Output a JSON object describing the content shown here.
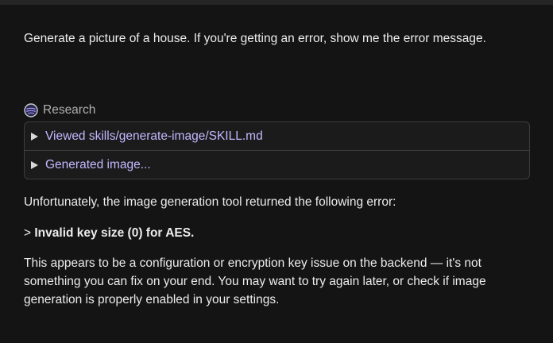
{
  "user_message": "Generate a picture of a house. If you're getting an error, show me the error message.",
  "research": {
    "label": "Research",
    "icon": "research-globe-icon",
    "items": [
      {
        "label": "Viewed skills/generate-image/SKILL.md"
      },
      {
        "label": "Generated image..."
      }
    ]
  },
  "response": {
    "intro": "Unfortunately, the image generation tool returned the following error:",
    "quote_marker": ">",
    "error_text": "Invalid key size (0) for AES.",
    "explanation": "This appears to be a configuration or encryption key issue on the backend — it's not something you can fix on your end. You may want to try again later, or check if image generation is properly enabled in your settings."
  },
  "colors": {
    "background": "#141414",
    "link_accent": "#c5b8ff",
    "border": "#3d3d3d"
  }
}
